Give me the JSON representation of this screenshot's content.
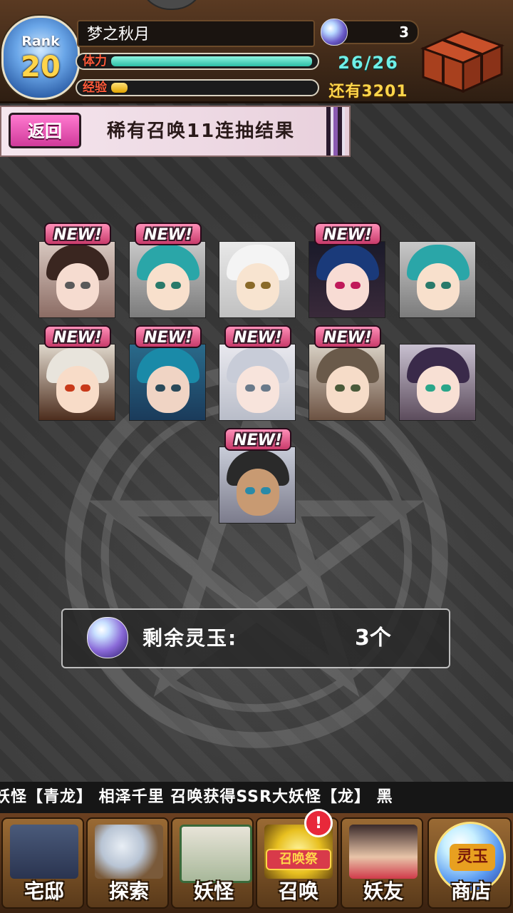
{
  "status": {
    "rank_label": "Rank",
    "rank_value": "20",
    "player_name": "梦之秋月",
    "gems": "3",
    "stamina_label": "体力",
    "stamina_text": "26/26",
    "stamina_fraction": 1.0,
    "exp_label": "经验",
    "exp_text": "还有3201",
    "exp_fraction": 0.08
  },
  "header": {
    "back_label": "返回",
    "title": "稀有召唤11连抽结果"
  },
  "results": [
    {
      "new": true,
      "new_label": "NEW!"
    },
    {
      "new": true,
      "new_label": "NEW!"
    },
    {
      "new": false
    },
    {
      "new": true,
      "new_label": "NEW!"
    },
    {
      "new": false
    },
    {
      "new": true,
      "new_label": "NEW!"
    },
    {
      "new": true,
      "new_label": "NEW!"
    },
    {
      "new": true,
      "new_label": "NEW!"
    },
    {
      "new": true,
      "new_label": "NEW!"
    },
    {
      "new": false
    },
    {
      "new": true,
      "new_label": "NEW!"
    }
  ],
  "remaining": {
    "label": "剩余灵玉:",
    "value": "3个"
  },
  "ticker": {
    "text": "妖怪【青龙】   相泽千里 召唤获得SSR大妖怪【龙】   黑"
  },
  "nav": {
    "items": [
      {
        "label": "宅邸"
      },
      {
        "label": "探索"
      },
      {
        "label": "妖怪"
      },
      {
        "label": "召唤",
        "badge": "!",
        "festival": "召唤祭"
      },
      {
        "label": "妖友"
      },
      {
        "label": "商店",
        "orb_text": "灵玉"
      }
    ]
  },
  "colors": {
    "accent_pink": "#d03a9a",
    "stamina": "#2cbfa6",
    "exp": "#e0a400",
    "gold_text": "#ffd54a"
  }
}
